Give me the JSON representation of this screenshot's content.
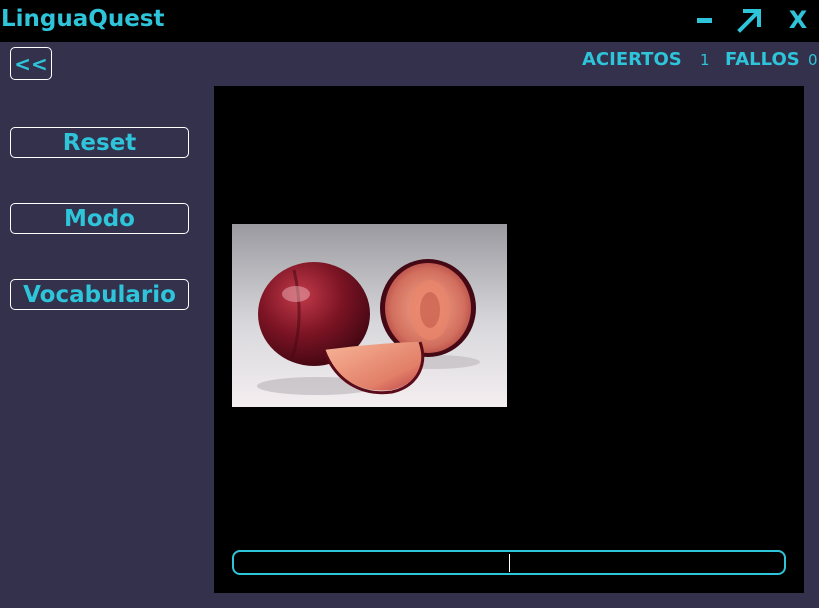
{
  "app": {
    "title": "LinguaQuest"
  },
  "window_controls": {
    "close_label": "X"
  },
  "nav": {
    "back_label": "<<"
  },
  "score": {
    "hits_label": "ACIERTOS",
    "hits_value": "1",
    "misses_label": "FALLOS",
    "misses_value": "0"
  },
  "sidebar": {
    "reset_label": "Reset",
    "mode_label": "Modo",
    "vocab_label": "Vocabulario"
  },
  "colors": {
    "accent": "#2ec4d9",
    "background": "#33314c",
    "panel": "#000000"
  },
  "icons": [
    "minimize-icon",
    "maximize-arrow-icon",
    "close-icon"
  ],
  "answer": {
    "value": ""
  }
}
